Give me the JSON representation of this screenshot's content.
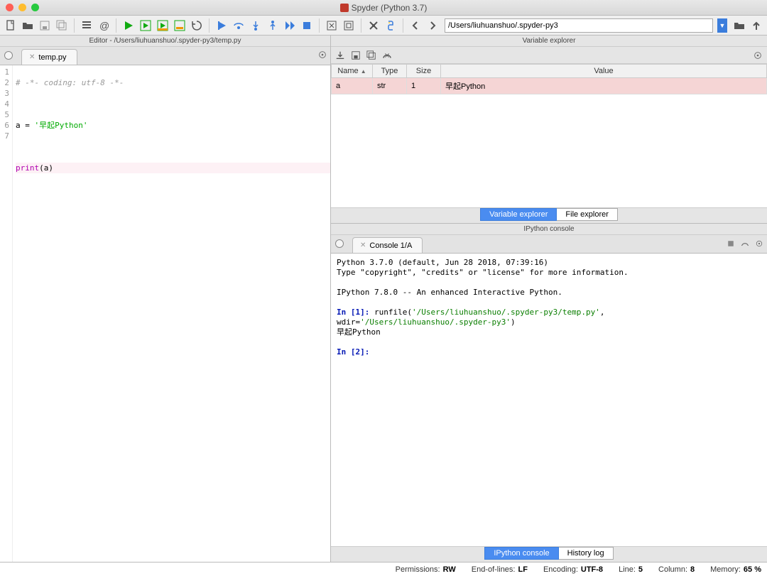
{
  "window": {
    "title": "Spyder (Python 3.7)"
  },
  "toolbar": {
    "path": "/Users/liuhuanshuo/.spyder-py3"
  },
  "editor": {
    "panel_title": "Editor - /Users/liuhuanshuo/.spyder-py3/temp.py",
    "tab": "temp.py",
    "gutter": "1\n2\n3\n4\n5\n6\n7",
    "lines": {
      "l1_comment": "# -*- coding: utf-8 -*-",
      "l3_var": "a ",
      "l3_eq": "= ",
      "l3_str": "'早起Python'",
      "l5_fn": "print",
      "l5_open": "(",
      "l5_arg": "a",
      "l5_close": ")"
    }
  },
  "varexp": {
    "panel_title": "Variable explorer",
    "headers": {
      "name": "Name",
      "type": "Type",
      "size": "Size",
      "value": "Value"
    },
    "sort_indicator": "▲",
    "rows": [
      {
        "name": "a",
        "type": "str",
        "size": "1",
        "value": "早起Python"
      }
    ],
    "tabs": {
      "var": "Variable explorer",
      "file": "File explorer"
    }
  },
  "console": {
    "panel_title": "IPython console",
    "tab": "Console 1/A",
    "banner1": "Python 3.7.0 (default, Jun 28 2018, 07:39:16)",
    "banner2": "Type \"copyright\", \"credits\" or \"license\" for more information.",
    "banner3": "IPython 7.8.0 -- An enhanced Interactive Python.",
    "in1_label": "In [",
    "in1_num": "1",
    "in1_close": "]: ",
    "in1_call": "runfile(",
    "in1_path1": "'/Users/liuhuanshuo/.spyder-py3/temp.py'",
    "in1_mid": ", wdir=",
    "in1_path2": "'/Users/liuhuanshuo/.spyder-py3'",
    "in1_end": ")",
    "out1": "早起Python",
    "in2_label": "In [",
    "in2_num": "2",
    "in2_close": "]: ",
    "tabs": {
      "ipy": "IPython console",
      "hist": "History log"
    }
  },
  "status": {
    "perm_l": "Permissions:",
    "perm_v": "RW",
    "eol_l": "End-of-lines:",
    "eol_v": "LF",
    "enc_l": "Encoding:",
    "enc_v": "UTF-8",
    "line_l": "Line:",
    "line_v": "5",
    "col_l": "Column:",
    "col_v": "8",
    "mem_l": "Memory:",
    "mem_v": "65 %"
  }
}
